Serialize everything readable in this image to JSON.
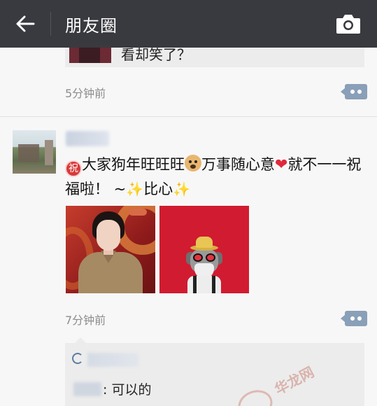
{
  "header": {
    "title": "朋友圈",
    "back_icon": "arrow-left-icon",
    "camera_icon": "camera-icon",
    "bg_color": "#393a3f"
  },
  "prev_post": {
    "text_snippet": "看却笑了？",
    "time": "5分钟前"
  },
  "post": {
    "text_line1_prefix": "祝",
    "text_part1": "大家狗年旺旺旺",
    "text_part2": "万事随心意",
    "text_part3": "就不一一祝福啦！ ~",
    "text_part4": "比心",
    "sparkle": "✨",
    "heart": "❤",
    "time": "7分钟前"
  },
  "comments": [
    {
      "text": ": 可以的"
    }
  ],
  "watermark": {
    "text": "华龙网"
  }
}
